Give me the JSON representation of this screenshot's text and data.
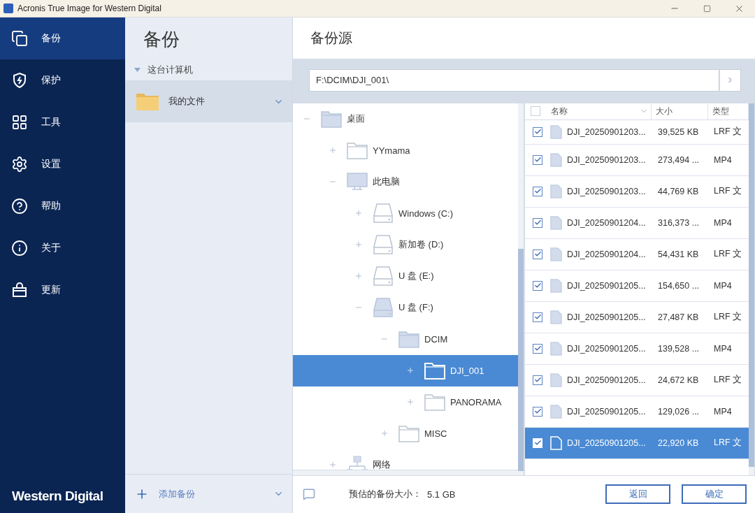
{
  "window": {
    "title": "Acronis True Image for Western Digital"
  },
  "sidebar": {
    "items": [
      {
        "label": "备份",
        "selected": true
      },
      {
        "label": "保护",
        "selected": false
      },
      {
        "label": "工具",
        "selected": false
      },
      {
        "label": "设置",
        "selected": false
      },
      {
        "label": "帮助",
        "selected": false
      },
      {
        "label": "关于",
        "selected": false
      },
      {
        "label": "更新",
        "selected": false
      }
    ],
    "brand": "Western Digital"
  },
  "backups": {
    "title": "备份",
    "group": {
      "label": "这台计算机",
      "expanded": true
    },
    "items": [
      {
        "label": "我的文件",
        "selected": true
      }
    ],
    "add_label": "添加备份"
  },
  "source": {
    "title": "备份源",
    "path": "F:\\DCIM\\DJI_001\\",
    "tree": [
      {
        "label": "桌面",
        "kind": "folder",
        "expanded": true,
        "selected": false,
        "children": [
          {
            "label": "YYmama",
            "kind": "folder",
            "expanded": false,
            "selected": false
          },
          {
            "label": "此电脑",
            "kind": "computer",
            "expanded": true,
            "selected": false,
            "children": [
              {
                "label": "Windows (C:)",
                "kind": "drive",
                "expanded": false,
                "selected": false
              },
              {
                "label": "新加卷 (D:)",
                "kind": "drive",
                "expanded": false,
                "selected": false
              },
              {
                "label": "U 盘 (E:)",
                "kind": "drive",
                "expanded": false,
                "selected": false
              },
              {
                "label": "U 盘 (F:)",
                "kind": "drive",
                "expanded": true,
                "selected": false,
                "children": [
                  {
                    "label": "DCIM",
                    "kind": "folder",
                    "expanded": true,
                    "selected": false,
                    "children": [
                      {
                        "label": "DJI_001",
                        "kind": "folder",
                        "expanded": false,
                        "selected": true
                      },
                      {
                        "label": "PANORAMA",
                        "kind": "folder",
                        "expanded": false,
                        "selected": false
                      }
                    ]
                  },
                  {
                    "label": "MISC",
                    "kind": "folder",
                    "expanded": false,
                    "selected": false
                  }
                ]
              }
            ]
          },
          {
            "label": "网络",
            "kind": "network",
            "expanded": false,
            "selected": false
          }
        ]
      }
    ],
    "files": {
      "columns": [
        "名称",
        "大小",
        "类型"
      ],
      "all_checked": false,
      "rows": [
        {
          "name": "DJI_20250901203...",
          "size": "39,525 KB",
          "type": "LRF 文",
          "checked": true,
          "selected": false
        },
        {
          "name": "DJI_20250901203...",
          "size": "273,494 ...",
          "type": "MP4",
          "checked": true,
          "selected": false
        },
        {
          "name": "DJI_20250901203...",
          "size": "44,769 KB",
          "type": "LRF 文",
          "checked": true,
          "selected": false
        },
        {
          "name": "DJI_20250901204...",
          "size": "316,373 ...",
          "type": "MP4",
          "checked": true,
          "selected": false
        },
        {
          "name": "DJI_20250901204...",
          "size": "54,431 KB",
          "type": "LRF 文",
          "checked": true,
          "selected": false
        },
        {
          "name": "DJI_20250901205...",
          "size": "154,650 ...",
          "type": "MP4",
          "checked": true,
          "selected": false
        },
        {
          "name": "DJI_20250901205...",
          "size": "27,487 KB",
          "type": "LRF 文",
          "checked": true,
          "selected": false
        },
        {
          "name": "DJI_20250901205...",
          "size": "139,528 ...",
          "type": "MP4",
          "checked": true,
          "selected": false
        },
        {
          "name": "DJI_20250901205...",
          "size": "24,672 KB",
          "type": "LRF 文",
          "checked": true,
          "selected": false
        },
        {
          "name": "DJI_20250901205...",
          "size": "129,026 ...",
          "type": "MP4",
          "checked": true,
          "selected": false
        },
        {
          "name": "DJI_20250901205...",
          "size": "22,920 KB",
          "type": "LRF 文",
          "checked": true,
          "selected": true
        }
      ]
    },
    "estimate_label": "预估的备份大小：",
    "estimate_value": "5.1 GB",
    "buttons": [
      "返回",
      "确定"
    ]
  }
}
